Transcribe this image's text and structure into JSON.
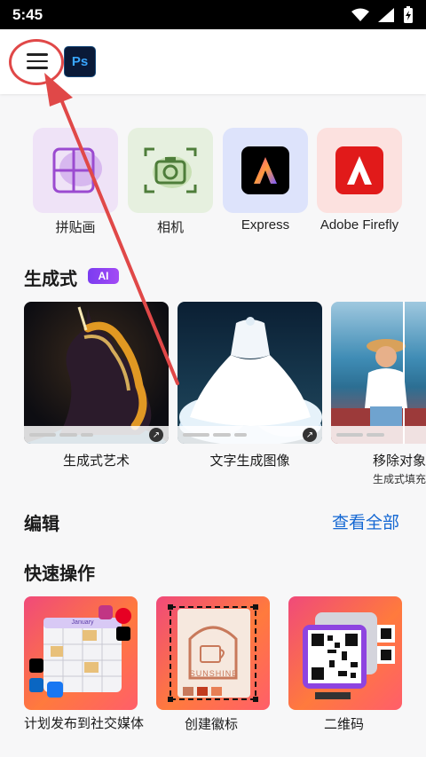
{
  "status": {
    "time": "5:45"
  },
  "appbar": {
    "ps_logo": "Ps"
  },
  "apps": [
    {
      "label": "拼贴画",
      "icon": "collage-icon"
    },
    {
      "label": "相机",
      "icon": "camera-icon"
    },
    {
      "label": "Express",
      "icon": "adobe-express-icon"
    },
    {
      "label": "Adobe Firefly",
      "icon": "adobe-firefly-icon"
    }
  ],
  "generative": {
    "title": "生成式",
    "badge": "AI",
    "cards": [
      {
        "label": "生成式艺术",
        "sublabel": ""
      },
      {
        "label": "文字生成图像",
        "sublabel": ""
      },
      {
        "label": "移除对象",
        "sublabel": "生成式填充"
      }
    ]
  },
  "edit": {
    "title": "编辑",
    "view_all": "查看全部"
  },
  "quick_actions": {
    "title": "快速操作",
    "cards": [
      {
        "label": "计划发布到社交媒体",
        "calendar_header": "January"
      },
      {
        "label": "创建徽标",
        "logo_text": "SUNSHINE"
      },
      {
        "label": "二维码"
      }
    ]
  },
  "colors": {
    "accent_blue": "#1568d3",
    "annotation_red": "#e04848",
    "ai_purple": "#7b3cf0"
  }
}
